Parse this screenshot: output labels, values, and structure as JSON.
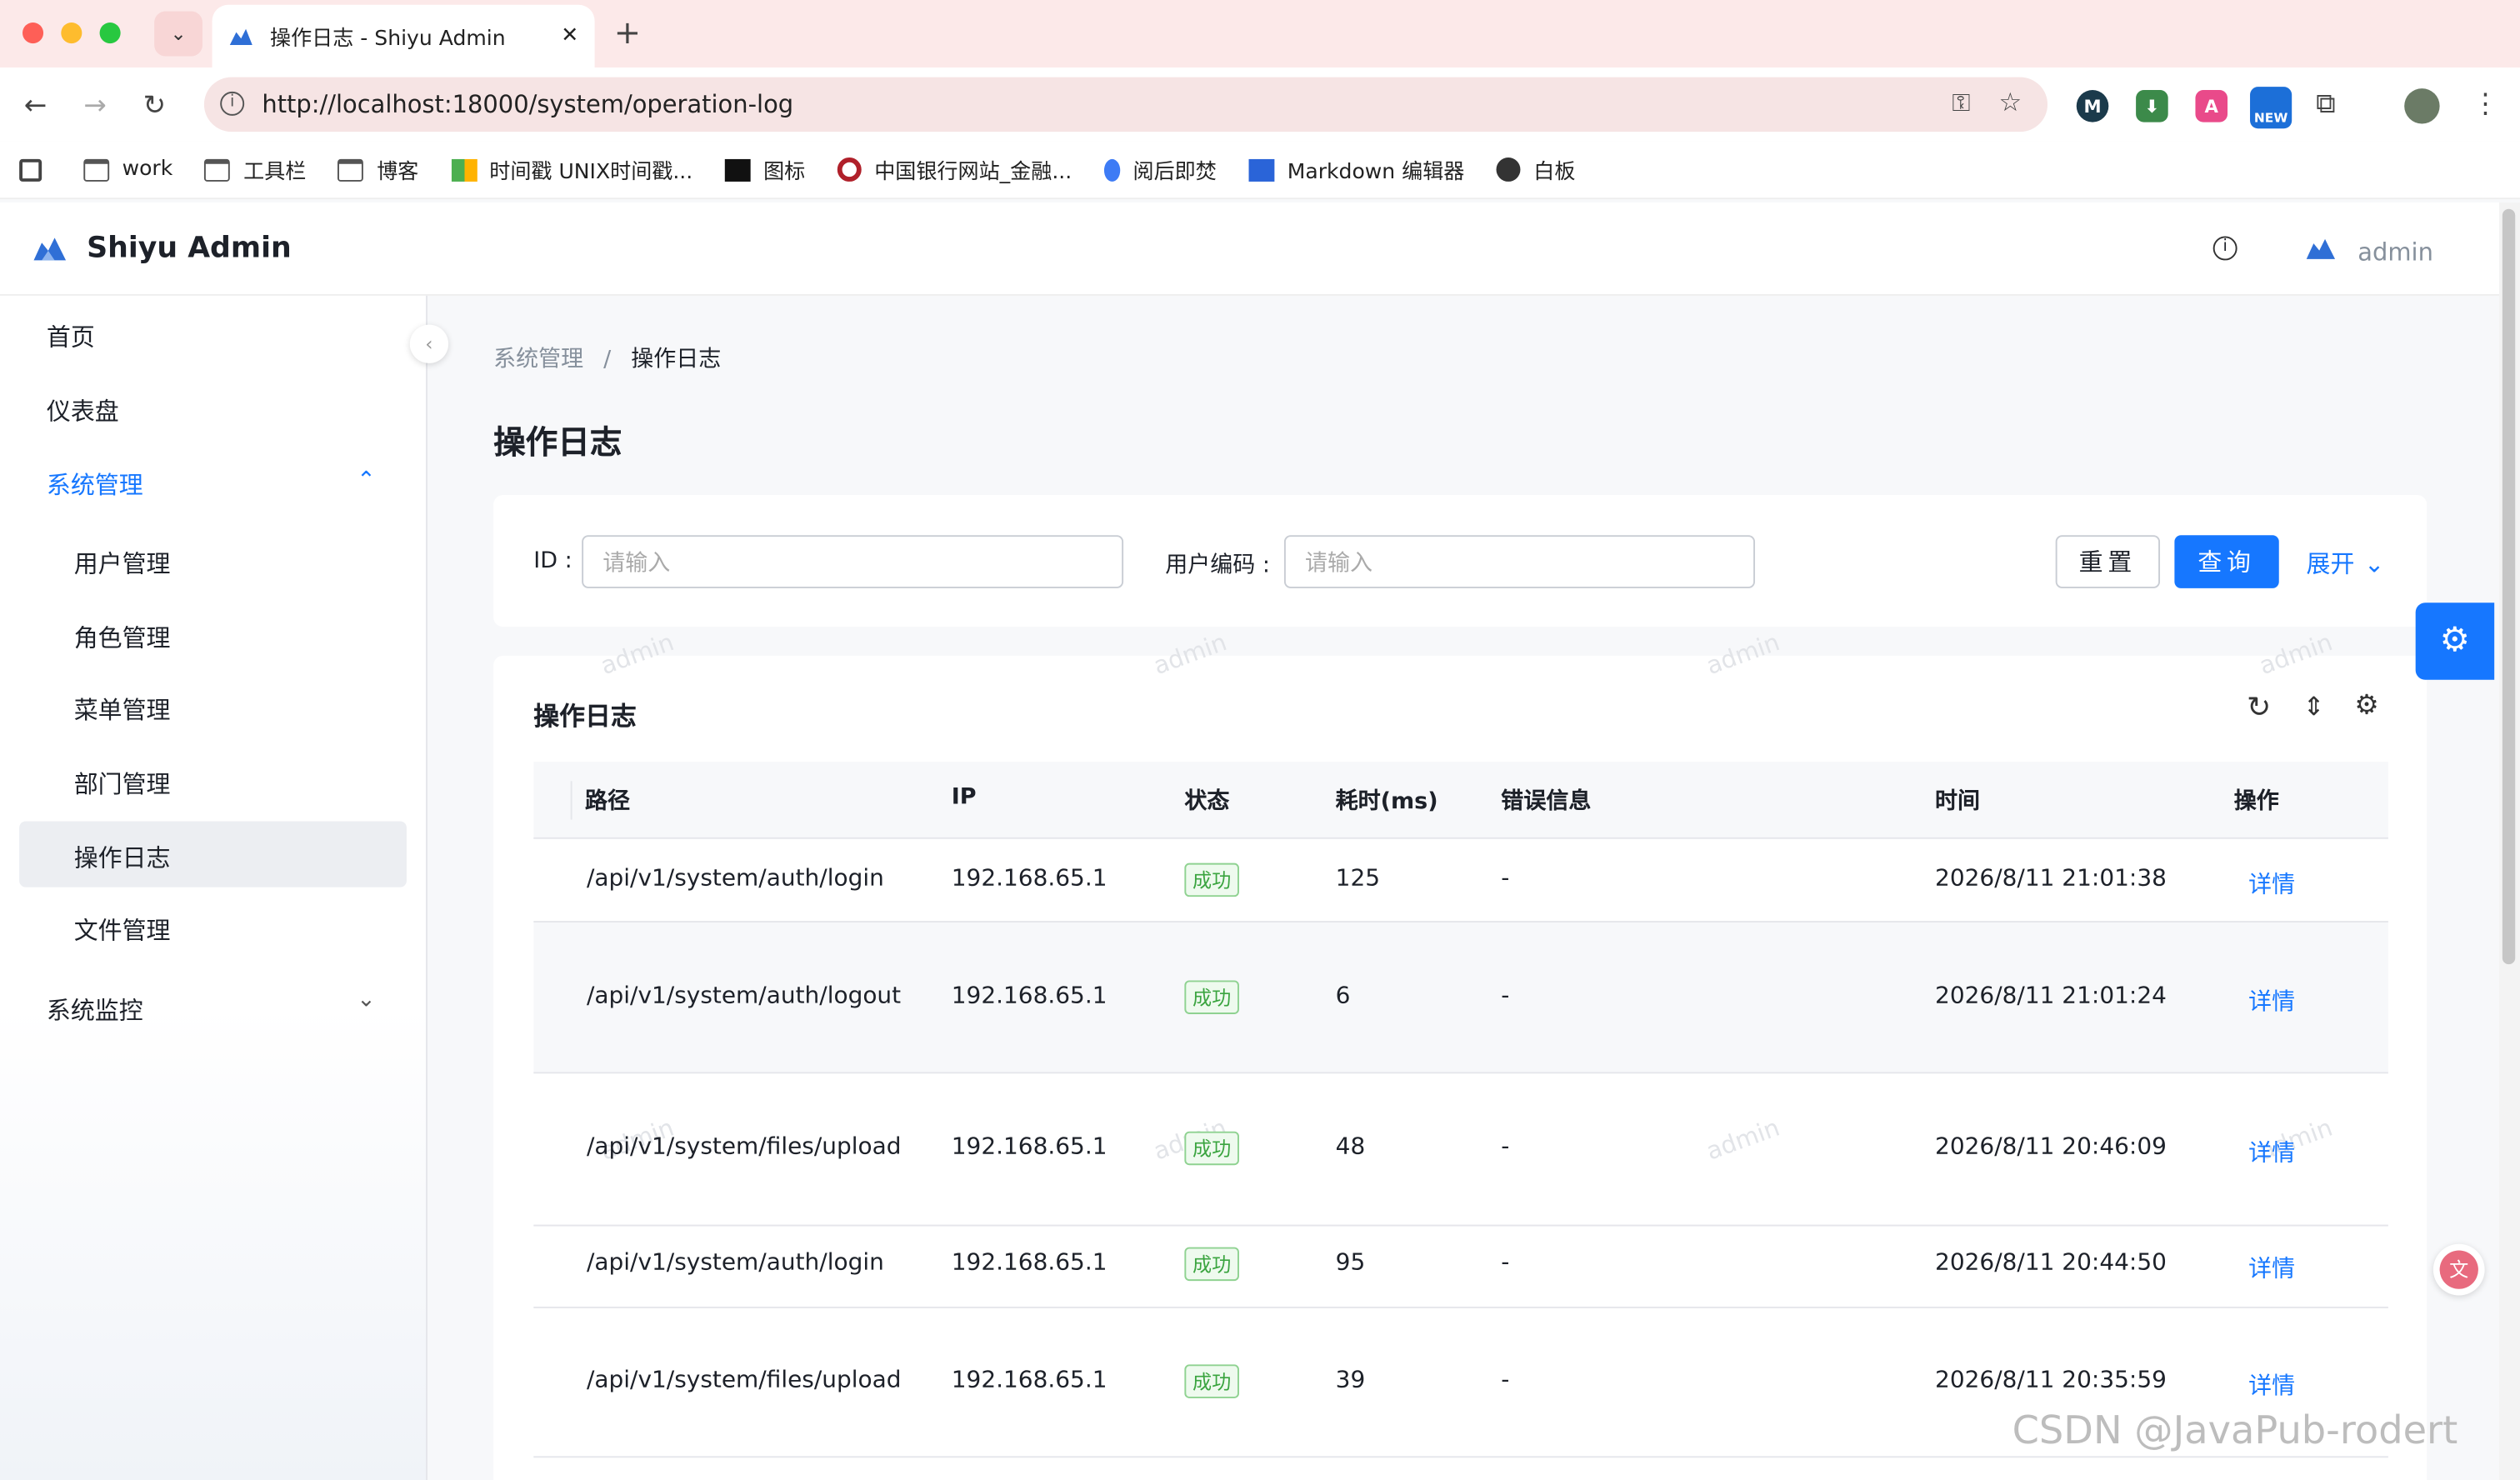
{
  "browser": {
    "tab_title": "操作日志 - Shiyu Admin",
    "url": "http://localhost:18000/system/operation-log",
    "bookmarks": [
      {
        "label": "work",
        "icon": "folder-icon"
      },
      {
        "label": "工具栏",
        "icon": "folder-icon"
      },
      {
        "label": "博客",
        "icon": "folder-icon"
      },
      {
        "label": "时间戳 UNIX时间戳...",
        "icon": "puzzle-icon"
      },
      {
        "label": "图标",
        "icon": "a-logo-icon"
      },
      {
        "label": "中国银行网站_金融...",
        "icon": "bank-icon"
      },
      {
        "label": "阅后即焚",
        "icon": "flame-icon"
      },
      {
        "label": "Markdown 编辑器",
        "icon": "editor-icon"
      },
      {
        "label": "白板",
        "icon": "globe-icon"
      }
    ],
    "extension_badge": "NEW"
  },
  "app": {
    "brand": "Shiyu Admin",
    "user": "admin"
  },
  "sidebar": {
    "items": [
      {
        "label": "首页"
      },
      {
        "label": "仪表盘"
      },
      {
        "label": "系统管理"
      },
      {
        "label": "用户管理"
      },
      {
        "label": "角色管理"
      },
      {
        "label": "菜单管理"
      },
      {
        "label": "部门管理"
      },
      {
        "label": "操作日志"
      },
      {
        "label": "文件管理"
      },
      {
        "label": "系统监控"
      }
    ]
  },
  "breadcrumb": {
    "parent": "系统管理",
    "sep": "/",
    "current": "操作日志"
  },
  "page_title": "操作日志",
  "search": {
    "id_label": "ID :",
    "id_placeholder": "请输入",
    "usercode_label": "用户编码 :",
    "usercode_placeholder": "请输入",
    "reset": "重置",
    "query": "查询",
    "expand": "展开"
  },
  "table": {
    "title": "操作日志",
    "columns": [
      "路径",
      "IP",
      "状态",
      "耗时(ms)",
      "错误信息",
      "时间",
      "操作"
    ],
    "rows": [
      {
        "path": "/api/v1/system/auth/login",
        "ip": "192.168.65.1",
        "status": "成功",
        "ms": "125",
        "err": "-",
        "time": "2026/8/11 21:01:38",
        "action": "详情"
      },
      {
        "path": "/api/v1/system/auth/logout",
        "ip": "192.168.65.1",
        "status": "成功",
        "ms": "6",
        "err": "-",
        "time": "2026/8/11 21:01:24",
        "action": "详情"
      },
      {
        "path": "/api/v1/system/files/upload",
        "ip": "192.168.65.1",
        "status": "成功",
        "ms": "48",
        "err": "-",
        "time": "2026/8/11 20:46:09",
        "action": "详情"
      },
      {
        "path": "/api/v1/system/auth/login",
        "ip": "192.168.65.1",
        "status": "成功",
        "ms": "95",
        "err": "-",
        "time": "2026/8/11 20:44:50",
        "action": "详情"
      },
      {
        "path": "/api/v1/system/files/upload",
        "ip": "192.168.65.1",
        "status": "成功",
        "ms": "39",
        "err": "-",
        "time": "2026/8/11 20:35:59",
        "action": "详情"
      }
    ]
  },
  "watermark": "admin",
  "csdn_watermark": "CSDN @JavaPub-rodert",
  "colors": {
    "primary": "#1677ff",
    "success": "#3aa43f",
    "tabbar": "#fce9e9"
  }
}
